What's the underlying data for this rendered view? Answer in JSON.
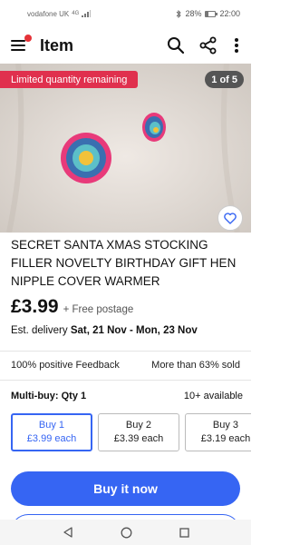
{
  "status_bar": {
    "carrier": "vodafone UK",
    "network": "4G",
    "battery_percent": "28%",
    "time": "22:00"
  },
  "header": {
    "title": "Item"
  },
  "gallery": {
    "badge": "Limited quantity remaining",
    "counter": "1 of 5"
  },
  "item": {
    "title": "SECRET SANTA XMAS STOCKING FILLER NOVELTY BIRTHDAY GIFT HEN NIPPLE COVER WARMER",
    "price": "£3.99",
    "postage": "+ Free postage",
    "delivery_label": "Est. delivery",
    "delivery_dates": "Sat, 21 Nov - Mon, 23 Nov"
  },
  "seller": {
    "feedback": "100% positive Feedback",
    "sold": "More than 63% sold"
  },
  "multibuy": {
    "label": "Multi-buy: Qty 1",
    "available": "10+ available",
    "options": [
      {
        "title": "Buy 1",
        "price": "£3.99 each"
      },
      {
        "title": "Buy 2",
        "price": "£3.39 each"
      },
      {
        "title": "Buy 3",
        "price": "£3.19 each"
      }
    ]
  },
  "actions": {
    "buy_now": "Buy it now"
  },
  "colors": {
    "accent": "#3665f3",
    "badge_red": "#e0304e",
    "notification": "#e53238"
  },
  "icons": [
    "menu-icon",
    "search-icon",
    "share-icon",
    "more-vertical-icon",
    "heart-icon",
    "back-icon",
    "home-icon",
    "recents-icon"
  ]
}
